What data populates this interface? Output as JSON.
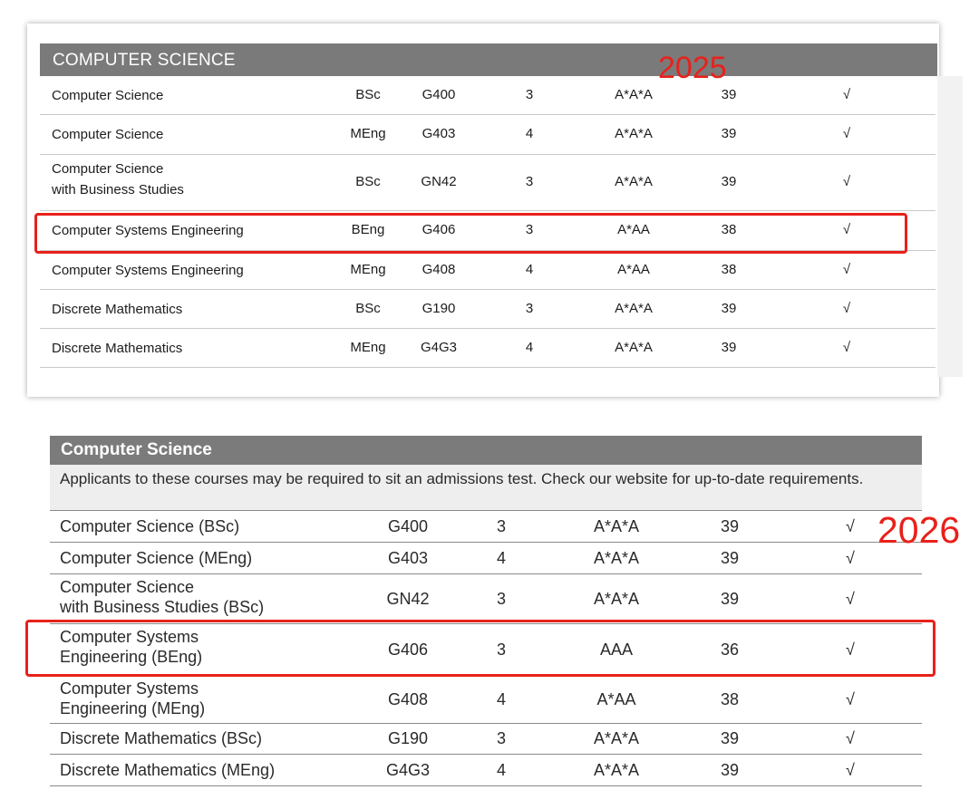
{
  "table_2025": {
    "header": "COMPUTER SCIENCE",
    "rows": [
      {
        "title": [
          "Computer Science"
        ],
        "degree": "BSc",
        "code": "G400",
        "years": "3",
        "a_level": "A*A*A",
        "ib": "39",
        "flag": "√"
      },
      {
        "title": [
          "Computer Science"
        ],
        "degree": "MEng",
        "code": "G403",
        "years": "4",
        "a_level": "A*A*A",
        "ib": "39",
        "flag": "√"
      },
      {
        "title": [
          "Computer Science",
          "with Business Studies"
        ],
        "degree": "BSc",
        "code": "GN42",
        "years": "3",
        "a_level": "A*A*A",
        "ib": "39",
        "flag": "√"
      },
      {
        "title": [
          "Computer Systems Engineering"
        ],
        "degree": "BEng",
        "code": "G406",
        "years": "3",
        "a_level": "A*AA",
        "ib": "38",
        "flag": "√"
      },
      {
        "title": [
          "Computer Systems Engineering"
        ],
        "degree": "MEng",
        "code": "G408",
        "years": "4",
        "a_level": "A*AA",
        "ib": "38",
        "flag": "√"
      },
      {
        "title": [
          "Discrete Mathematics"
        ],
        "degree": "BSc",
        "code": "G190",
        "years": "3",
        "a_level": "A*A*A",
        "ib": "39",
        "flag": "√"
      },
      {
        "title": [
          "Discrete Mathematics"
        ],
        "degree": "MEng",
        "code": "G4G3",
        "years": "4",
        "a_level": "A*A*A",
        "ib": "39",
        "flag": "√"
      }
    ]
  },
  "table_2026": {
    "header": "Computer Science",
    "note": "Applicants to these courses may be required to sit an admissions test. Check our website for up-to-date requirements.",
    "rows": [
      {
        "title": [
          "Computer Science (BSc)"
        ],
        "code": "G400",
        "years": "3",
        "a_level": "A*A*A",
        "ib": "39",
        "flag": "√"
      },
      {
        "title": [
          "Computer Science (MEng)"
        ],
        "code": "G403",
        "years": "4",
        "a_level": "A*A*A",
        "ib": "39",
        "flag": "√"
      },
      {
        "title": [
          "Computer Science",
          "with Business Studies (BSc)"
        ],
        "code": "GN42",
        "years": "3",
        "a_level": "A*A*A",
        "ib": "39",
        "flag": "√"
      },
      {
        "title": [
          "Computer Systems",
          "Engineering (BEng)"
        ],
        "code": "G406",
        "years": "3",
        "a_level": "AAA",
        "ib": "36",
        "flag": "√"
      },
      {
        "title": [
          "Computer Systems",
          "Engineering (MEng)"
        ],
        "code": "G408",
        "years": "4",
        "a_level": "A*AA",
        "ib": "38",
        "flag": "√"
      },
      {
        "title": [
          "Discrete Mathematics (BSc)"
        ],
        "code": "G190",
        "years": "3",
        "a_level": "A*A*A",
        "ib": "39",
        "flag": "√"
      },
      {
        "title": [
          "Discrete Mathematics (MEng)"
        ],
        "code": "G4G3",
        "years": "4",
        "a_level": "A*A*A",
        "ib": "39",
        "flag": "√"
      }
    ]
  },
  "annotations": {
    "year_top": "2025",
    "year_bottom": "2026",
    "highlight_color": "#e8211b"
  }
}
